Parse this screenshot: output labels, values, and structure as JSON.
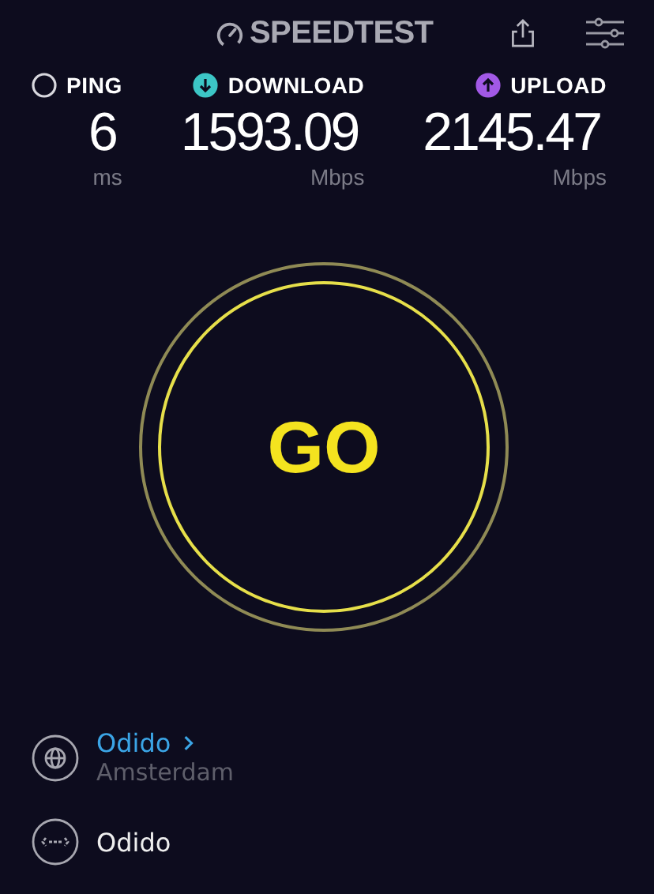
{
  "header": {
    "logo": "SPEEDTEST"
  },
  "metrics": [
    {
      "kind": "ping",
      "label": "PING",
      "value": "6",
      "unit": "ms",
      "color": "#d8d8de"
    },
    {
      "kind": "download",
      "label": "DOWNLOAD",
      "value": "1593.09",
      "unit": "Mbps",
      "color": "#3cc6c6"
    },
    {
      "kind": "upload",
      "label": "UPLOAD",
      "value": "2145.47",
      "unit": "Mbps",
      "color": "#a259e6"
    }
  ],
  "go_button": {
    "label": "GO"
  },
  "server": {
    "provider": "Odido",
    "location": "Amsterdam"
  },
  "connection": {
    "label": "Odido"
  }
}
